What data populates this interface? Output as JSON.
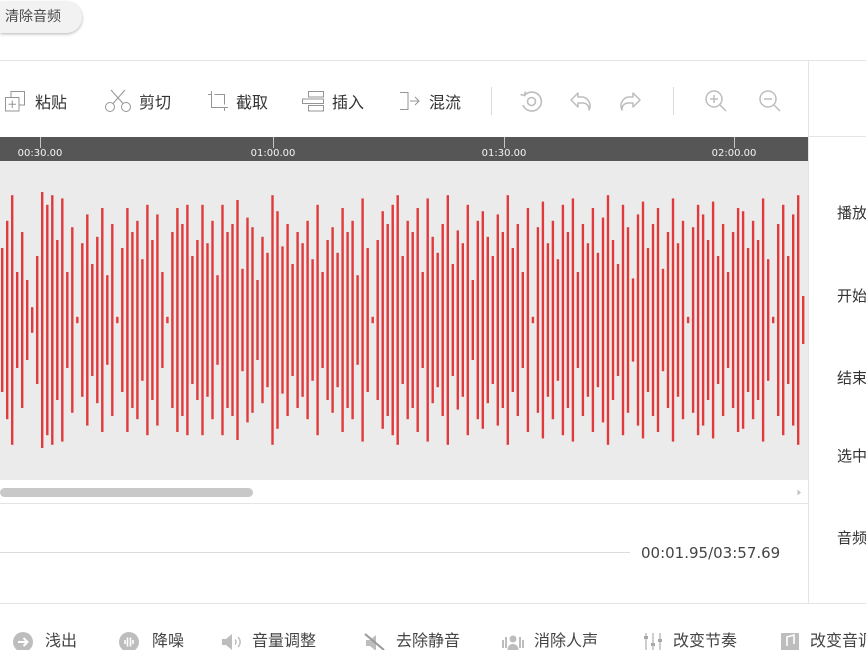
{
  "top": {
    "clear_audio_label": "清除音频"
  },
  "toolbar": {
    "paste": {
      "label": "粘贴",
      "icon": "paste-icon"
    },
    "cut": {
      "label": "剪切",
      "icon": "scissors-icon"
    },
    "trim": {
      "label": "截取",
      "icon": "crop-icon"
    },
    "insert": {
      "label": "插入",
      "icon": "insert-icon"
    },
    "mix": {
      "label": "混流",
      "icon": "mix-icon"
    },
    "icon_buttons": [
      "history-icon",
      "undo-icon",
      "redo-icon",
      "zoom-in-icon",
      "zoom-out-icon"
    ]
  },
  "timeline": {
    "ticks": [
      "00:30.00",
      "01:00.00",
      "01:30.00",
      "02:00.00"
    ]
  },
  "waveform": {
    "color": "#e03a3c",
    "background": "#ebebeb",
    "amplitudes": [
      0.45,
      0.62,
      0.78,
      0.3,
      0.55,
      0.25,
      0.08,
      0.4,
      0.8,
      0.72,
      0.78,
      0.5,
      0.76,
      0.3,
      0.58,
      0.02,
      0.48,
      0.66,
      0.35,
      0.52,
      0.7,
      0.28,
      0.6,
      0.02,
      0.45,
      0.7,
      0.55,
      0.62,
      0.38,
      0.72,
      0.5,
      0.66,
      0.3,
      0.02,
      0.55,
      0.7,
      0.6,
      0.72,
      0.4,
      0.5,
      0.72,
      0.48,
      0.62,
      0.28,
      0.72,
      0.55,
      0.6,
      0.75,
      0.32,
      0.64,
      0.58,
      0.25,
      0.52,
      0.42,
      0.78,
      0.68,
      0.46,
      0.6,
      0.35,
      0.55,
      0.48,
      0.62,
      0.38,
      0.72,
      0.3,
      0.5,
      0.58,
      0.42,
      0.7,
      0.55,
      0.62,
      0.28,
      0.76,
      0.45,
      0.02,
      0.5,
      0.68,
      0.6,
      0.72,
      0.78,
      0.4,
      0.62,
      0.55,
      0.7,
      0.3,
      0.76,
      0.52,
      0.42,
      0.6,
      0.78,
      0.35,
      0.56,
      0.48,
      0.72,
      0.25,
      0.62,
      0.68,
      0.52,
      0.4,
      0.66,
      0.55,
      0.78,
      0.45,
      0.6,
      0.3,
      0.7,
      0.02,
      0.58,
      0.74,
      0.48,
      0.62,
      0.38,
      0.72,
      0.55,
      0.76,
      0.3,
      0.6,
      0.48,
      0.7,
      0.42,
      0.64,
      0.78,
      0.5,
      0.35,
      0.72,
      0.58,
      0.26,
      0.66,
      0.74,
      0.45,
      0.6,
      0.7,
      0.32,
      0.55,
      0.76,
      0.48,
      0.62,
      0.02,
      0.58,
      0.72,
      0.66,
      0.5,
      0.74,
      0.4,
      0.6,
      0.3,
      0.55,
      0.7,
      0.68,
      0.45,
      0.62,
      0.5,
      0.76,
      0.38,
      0.02,
      0.6,
      0.72,
      0.4,
      0.66,
      0.78,
      0.15
    ]
  },
  "scrollbar": {
    "thumb_fraction": 0.32,
    "position": 0
  },
  "playback": {
    "time": "00:01.95/03:57.69"
  },
  "side_panel": {
    "labels": [
      "播放",
      "开始",
      "结束",
      "选中",
      "音频"
    ]
  },
  "effects": [
    {
      "label": "浅出",
      "icon": "fade-out-icon"
    },
    {
      "label": "降噪",
      "icon": "denoise-icon"
    },
    {
      "label": "音量调整",
      "icon": "volume-icon"
    },
    {
      "label": "去除静音",
      "icon": "remove-silence-icon"
    },
    {
      "label": "消除人声",
      "icon": "remove-vocal-icon"
    },
    {
      "label": "改变节奏",
      "icon": "tempo-icon"
    },
    {
      "label": "改变音调",
      "icon": "pitch-icon"
    }
  ]
}
